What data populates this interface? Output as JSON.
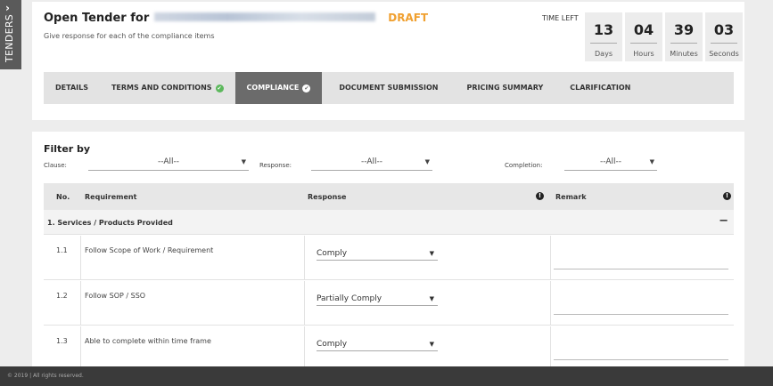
{
  "sidebar": {
    "tab_label": "TENDERS",
    "toggle_icon": "chevron-right-icon"
  },
  "header": {
    "title": "Open Tender for",
    "status": "DRAFT",
    "subtitle": "Give response for each of the compliance items"
  },
  "timer": {
    "label": "TIME LEFT",
    "days": "13",
    "days_label": "Days",
    "hours": "04",
    "hours_label": "Hours",
    "minutes": "39",
    "minutes_label": "Minutes",
    "seconds": "03",
    "seconds_label": "Seconds"
  },
  "tabs": [
    {
      "label": "DETAILS"
    },
    {
      "label": "TERMS AND CONDITIONS"
    },
    {
      "label": "COMPLIANCE"
    },
    {
      "label": "DOCUMENT SUBMISSION"
    },
    {
      "label": "PRICING SUMMARY"
    },
    {
      "label": "CLARIFICATION"
    }
  ],
  "filter": {
    "title": "Filter by",
    "clause_label": "Clause:",
    "clause_value": "--All--",
    "response_label": "Response:",
    "response_value": "--All--",
    "completion_label": "Completion:",
    "completion_value": "--All--"
  },
  "table": {
    "headers": {
      "no": "No.",
      "requirement": "Requirement",
      "response": "Response",
      "remark": "Remark"
    },
    "group": {
      "title": "1. Services / Products Provided",
      "toggle": "−"
    },
    "rows": [
      {
        "no": "1.1",
        "requirement": "Follow Scope of Work / Requirement",
        "response": "Comply"
      },
      {
        "no": "1.2",
        "requirement": "Follow SOP / SSO",
        "response": "Partially Comply"
      },
      {
        "no": "1.3",
        "requirement": "Able to complete within time frame",
        "response": "Comply"
      }
    ]
  },
  "footer": {
    "text": "© 2019 | All rights reserved."
  },
  "colors": {
    "draft": "#f0a030",
    "check": "#5cb85c",
    "active_tab": "#6b6b6b",
    "footer": "#3a3a3a"
  }
}
